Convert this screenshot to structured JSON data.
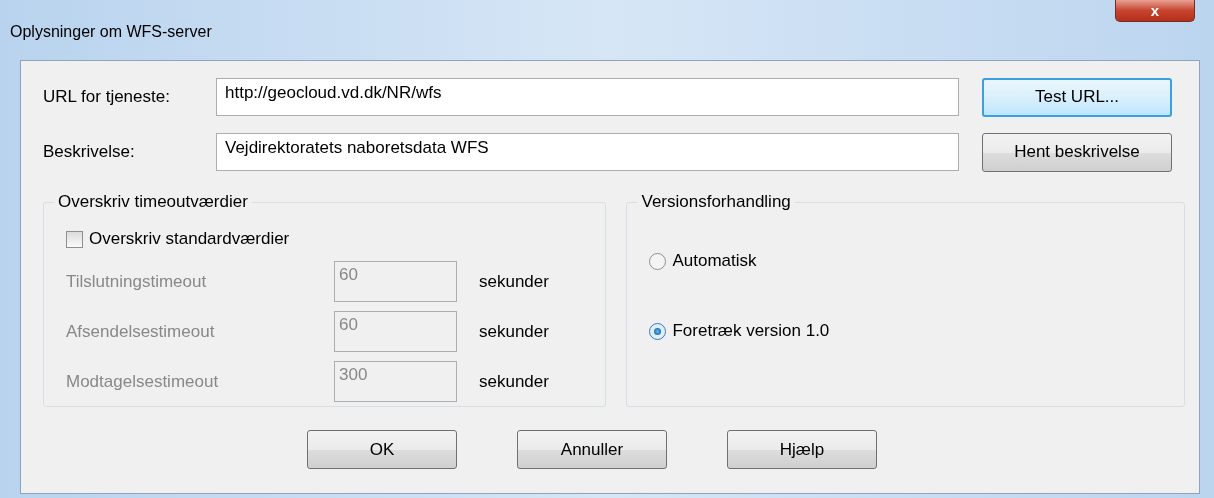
{
  "window": {
    "title": "Oplysninger om WFS-server",
    "close_label": "x"
  },
  "fields": [
    {
      "label": "URL for tjeneste:",
      "value": "http://geocloud.vd.dk/NR/wfs",
      "button": "Test URL...",
      "button_default": true
    },
    {
      "label": "Beskrivelse:",
      "value": "Vejdirektoratets naboretsdata WFS",
      "button": "Hent beskrivelse",
      "button_default": false
    }
  ],
  "timeouts": {
    "title": "Overskriv timeoutværdier",
    "override": {
      "label": "Overskriv standardværdier",
      "checked": false
    },
    "rows": [
      {
        "label": "Tilslutningstimeout",
        "value": "60",
        "unit": "sekunder",
        "disabled": true
      },
      {
        "label": "Afsendelsestimeout",
        "value": "60",
        "unit": "sekunder",
        "disabled": true
      },
      {
        "label": "Modtagelsestimeout",
        "value": "300",
        "unit": "sekunder",
        "disabled": true
      }
    ]
  },
  "version": {
    "title": "Versionsforhandling",
    "options": [
      {
        "label": "Automatisk",
        "selected": false
      },
      {
        "label": "Foretræk version 1.0",
        "selected": true
      }
    ]
  },
  "buttons": [
    "OK",
    "Annuller",
    "Hjælp"
  ]
}
